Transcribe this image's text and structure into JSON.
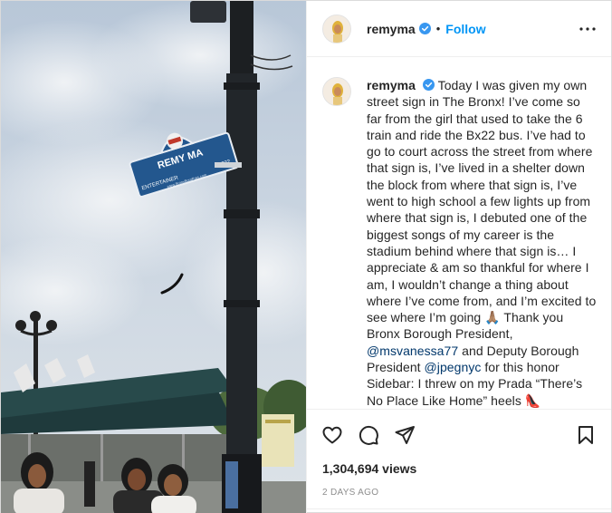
{
  "post": {
    "username": "remyma",
    "follow_label": "Follow",
    "separator": "•",
    "media": {
      "street_sign": {
        "name": "REMY MA",
        "subtitle": "ENTERTAINER",
        "year": "2022",
        "website": "www.BronxBoroPres.com"
      }
    },
    "caption": {
      "username": "remyma",
      "text_1": "Today I was given my own street sign in The Bronx! I’ve come so far from the girl that used to take the 6 train and ride the Bx22 bus. I’ve had to go to court across the street from where that sign is, I’ve lived in a shelter down the block from where that sign is, I’ve went to high school a few lights up from where that sign is, I debuted one of the biggest songs of my career is the stadium behind where that sign is… I appreciate & am so thankful for where I am, I wouldn’t change a thing about where I’ve come from, and I’m excited to see where I’m going 🙏🏽 Thank you Bronx Borough President, ",
      "mention_1": "@msvanessa77",
      "text_2": " and Deputy Borough President ",
      "mention_2": "@jpegnyc",
      "text_3": " for this honor Sidebar: I threw on my Prada “There’s No Place Like Home” heels 👠"
    },
    "views": "1,304,694 views",
    "posted": "2 DAYS AGO",
    "icons": {
      "like": "heart-icon",
      "comment": "comment-bubble-icon",
      "share": "paper-plane-icon",
      "save": "bookmark-icon",
      "more": "more-options-icon",
      "verified": "verified-badge-icon"
    },
    "colors": {
      "accent": "#0095f6",
      "verified": "#3897f0",
      "mention": "#00376b",
      "muted": "#8e8e8e"
    }
  }
}
